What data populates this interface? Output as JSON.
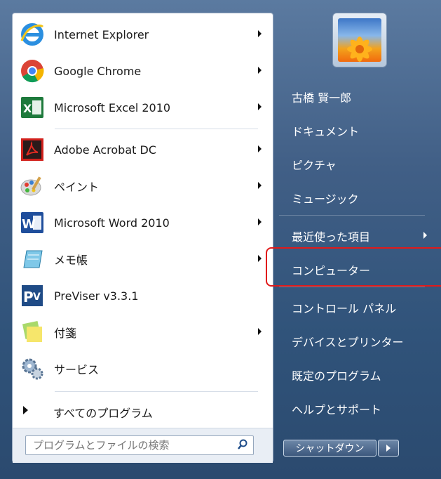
{
  "programs": [
    {
      "label": "Internet Explorer",
      "icon": "internet-explorer-icon",
      "has_arrow": true
    },
    {
      "label": "Google Chrome",
      "icon": "chrome-icon",
      "has_arrow": true
    },
    {
      "label": "Microsoft Excel 2010",
      "icon": "excel-icon",
      "has_arrow": true
    },
    {
      "label": "Adobe Acrobat DC",
      "icon": "acrobat-icon",
      "has_arrow": true
    },
    {
      "label": "ペイント",
      "icon": "paint-icon",
      "has_arrow": true
    },
    {
      "label": "Microsoft Word 2010",
      "icon": "word-icon",
      "has_arrow": true
    },
    {
      "label": "メモ帳",
      "icon": "notepad-icon",
      "has_arrow": true
    },
    {
      "label": "PreViser v3.3.1",
      "icon": "previser-icon",
      "has_arrow": false
    },
    {
      "label": "付箋",
      "icon": "sticky-notes-icon",
      "has_arrow": true
    },
    {
      "label": "サービス",
      "icon": "services-icon",
      "has_arrow": false
    }
  ],
  "all_programs": "すべてのプログラム",
  "search": {
    "placeholder": "プログラムとファイルの検索"
  },
  "right": {
    "user": "古橋 賢一郎",
    "items": [
      "ドキュメント",
      "ピクチャ",
      "ミュージック",
      "最近使った項目",
      "コンピューター",
      "コントロール パネル",
      "デバイスとプリンター",
      "既定のプログラム",
      "ヘルプとサポート"
    ],
    "highlighted": "コンピューター"
  },
  "shutdown": "シャットダウン",
  "colors": {
    "highlight_border": "#e11a1a",
    "panel": "#30537a"
  }
}
